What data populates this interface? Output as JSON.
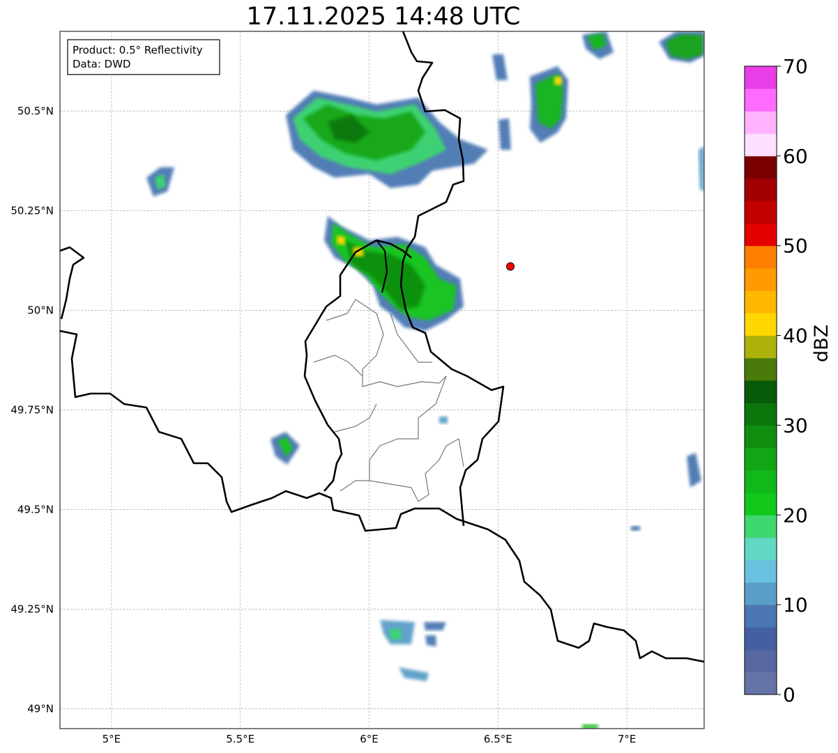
{
  "title": "17.11.2025 14:48 UTC",
  "info_box": {
    "product": "Product: 0.5° Reflectivity",
    "data": "Data: DWD"
  },
  "map": {
    "lon_range": [
      4.8,
      7.3
    ],
    "lat_range": [
      48.95,
      50.7
    ],
    "x_ticks": [
      {
        "value": 5.0,
        "label": "5°E"
      },
      {
        "value": 5.5,
        "label": "5.5°E"
      },
      {
        "value": 6.0,
        "label": "6°E"
      },
      {
        "value": 6.5,
        "label": "6.5°E"
      },
      {
        "value": 7.0,
        "label": "7°E"
      }
    ],
    "y_ticks": [
      {
        "value": 49.0,
        "label": "49°N"
      },
      {
        "value": 49.25,
        "label": "49.25°N"
      },
      {
        "value": 49.5,
        "label": "49.5°N"
      },
      {
        "value": 49.75,
        "label": "49.75°N"
      },
      {
        "value": 50.0,
        "label": "50°N"
      },
      {
        "value": 50.25,
        "label": "50.25°N"
      },
      {
        "value": 50.5,
        "label": "50.5°N"
      }
    ],
    "gridlines": true,
    "radar_site": {
      "lon": 6.548,
      "lat": 50.11,
      "color": "#ff0000"
    }
  },
  "colorbar": {
    "label": "dBZ",
    "min": 0,
    "max": 70,
    "step": 2.5,
    "tick_labels": [
      "0",
      "10",
      "20",
      "30",
      "40",
      "50",
      "60",
      "70"
    ],
    "colors": [
      "#6573a8",
      "#56689f",
      "#4460a3",
      "#4a77b2",
      "#5a9ec8",
      "#68c1de",
      "#60d8c2",
      "#3ed66f",
      "#12c81a",
      "#12b81a",
      "#12a615",
      "#108e10",
      "#0c760c",
      "#065a08",
      "#4a7a0a",
      "#adb20b",
      "#ffd700",
      "#ffb700",
      "#ff9a00",
      "#ff8000",
      "#e20000",
      "#c20000",
      "#a20000",
      "#7a0000",
      "#ffdfff",
      "#ffb3ff",
      "#ff6bff",
      "#e83ee8"
    ]
  }
}
